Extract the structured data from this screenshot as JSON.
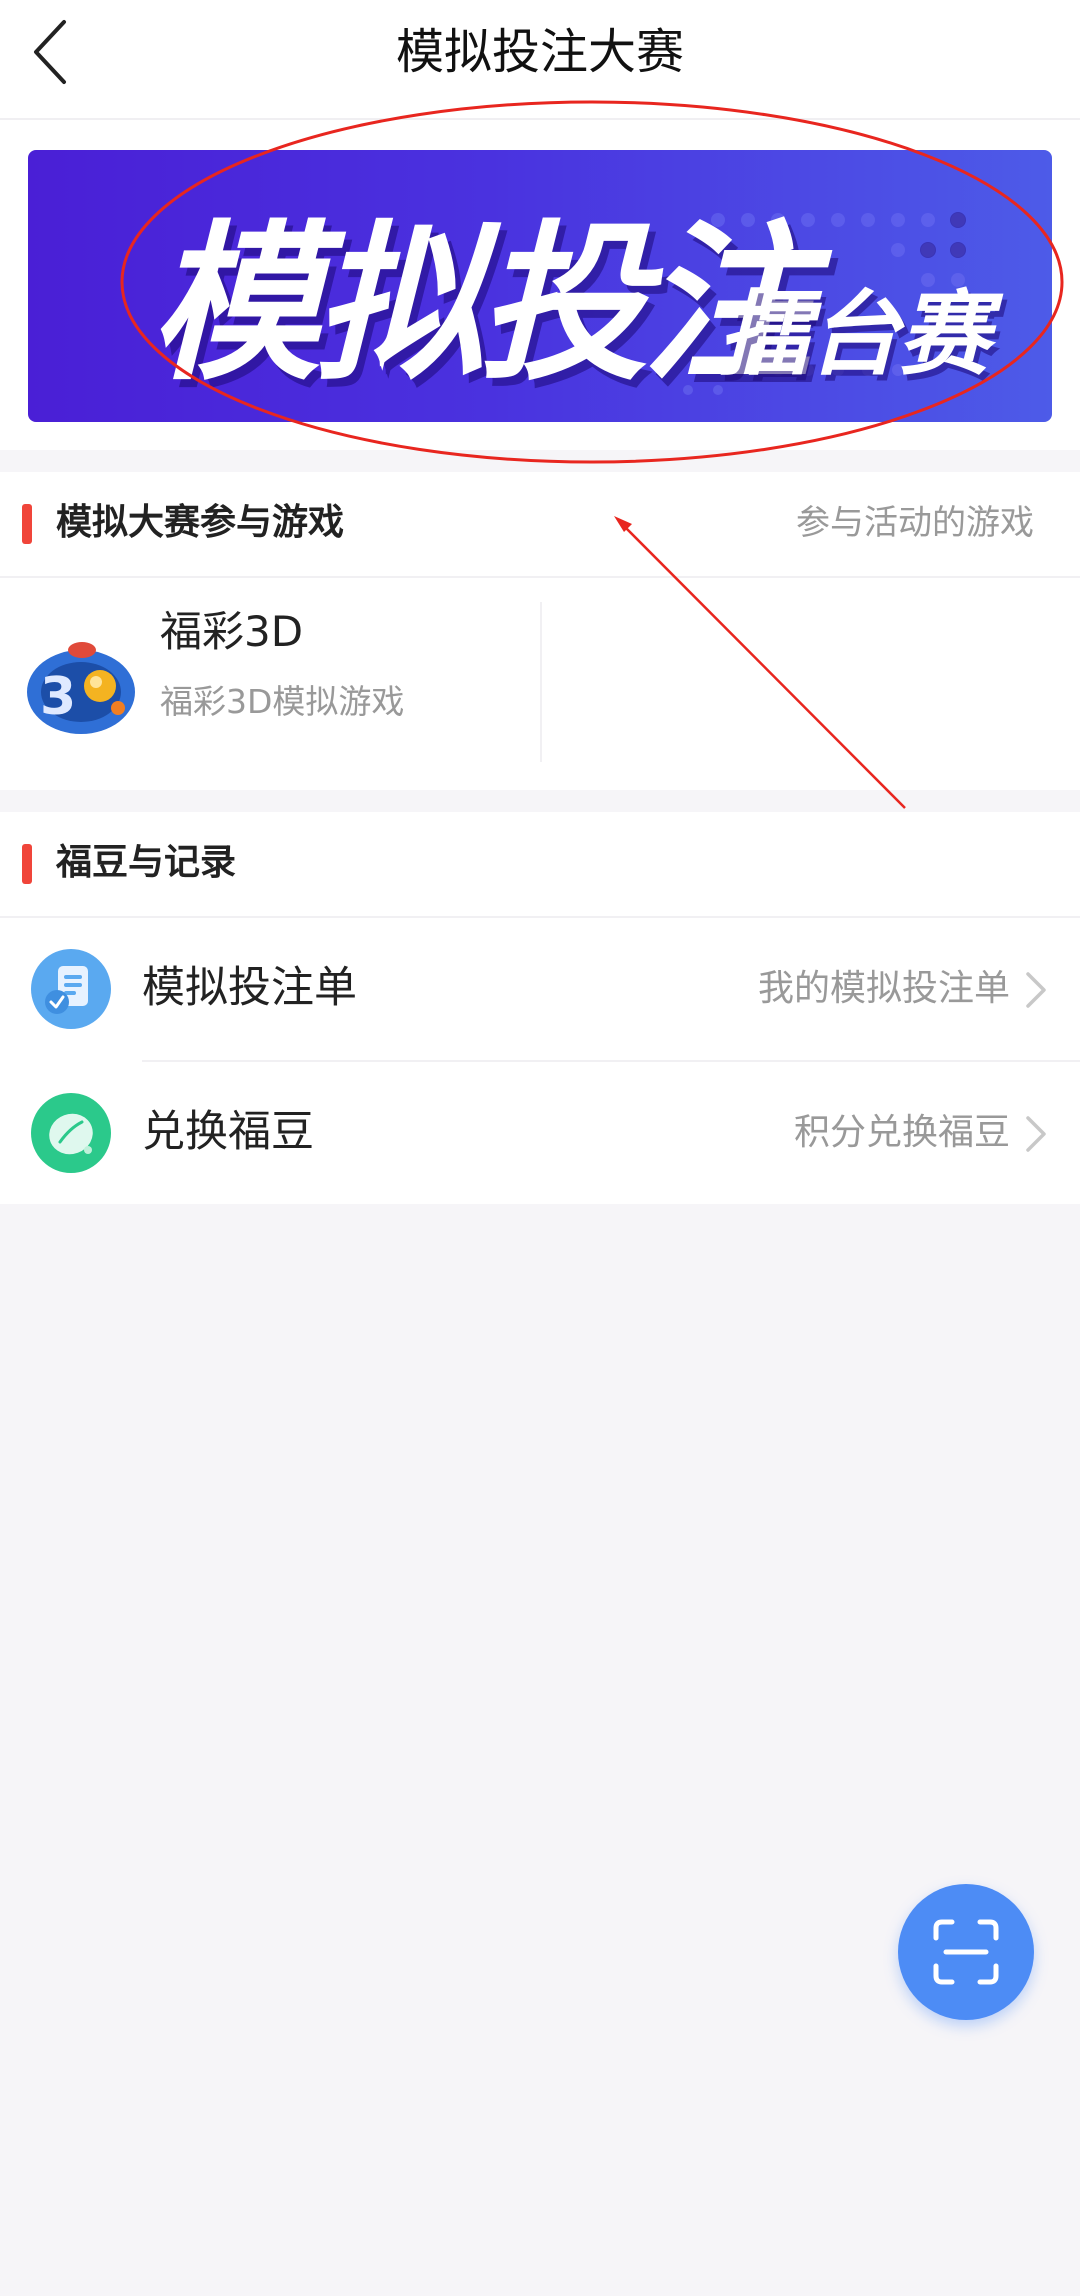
{
  "nav": {
    "title": "模拟投注大赛",
    "back_icon": "chevron-left-icon"
  },
  "banner": {
    "main": "模拟投注",
    "sub": "擂台赛"
  },
  "section_games": {
    "title": "模拟大赛参与游戏",
    "right": "参与活动的游戏",
    "games": [
      {
        "name": "福彩3D",
        "desc": "福彩3D模拟游戏",
        "icon": "fucai-3d-icon"
      }
    ]
  },
  "section_records": {
    "title": "福豆与记录",
    "rows": [
      {
        "label": "模拟投注单",
        "right": "我的模拟投注单",
        "icon": "document-check-icon",
        "icon_color": "#4aa3ee"
      },
      {
        "label": "兑换福豆",
        "right": "积分兑换福豆",
        "icon": "bean-icon",
        "icon_color": "#27c98a"
      }
    ]
  },
  "fab": {
    "icon": "scan-icon",
    "color": "#4d8cf5"
  },
  "colors": {
    "accent_bar": "#f0453a",
    "annotation": "#e8261f",
    "banner_start": "#4a1fd6",
    "banner_end": "#4d5be8"
  }
}
